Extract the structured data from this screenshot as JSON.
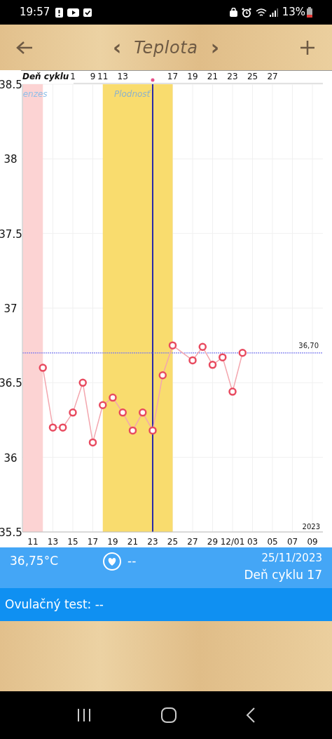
{
  "status_bar": {
    "time": "19:57",
    "battery": "13%"
  },
  "header": {
    "title": "Teplota",
    "prev": "‹",
    "next": "›"
  },
  "chart": {
    "chart_data": {
      "type": "line",
      "categories": [
        null,
        "11",
        null,
        "13",
        null,
        "15",
        null,
        "17",
        null,
        "19",
        null,
        "21",
        null,
        "23",
        null,
        "25",
        null,
        "27",
        null,
        "29",
        null,
        "12/01",
        null,
        "03",
        null,
        "05",
        null,
        "07",
        null,
        "09"
      ],
      "series": [
        {
          "color": "#e84a5f",
          "marker": "o",
          "values": [
            null,
            null,
            36.6,
            36.2,
            36.2,
            36.3,
            36.5,
            36.1,
            36.35,
            36.4,
            36.3,
            36.18,
            36.3,
            36.18,
            36.55,
            36.75,
            null,
            36.65,
            36.74,
            36.62,
            36.67,
            36.44,
            36.7,
            null,
            null,
            null,
            null,
            null,
            null,
            null
          ]
        }
      ],
      "ylim": [
        35.5,
        38.5
      ],
      "grid": true,
      "ref_lines": [
        {
          "axis": "y",
          "value": 36.7,
          "label": "36,70",
          "color": "#7b7bf0"
        }
      ],
      "yticks": [
        38.5,
        38,
        37.5,
        37,
        36.5,
        36,
        35.5
      ]
    },
    "top_axis_title": "Deň cyklu",
    "days": [
      {
        "kind": "menstruation"
      },
      {
        "kind": "menstruation"
      },
      {
        "kind": "normal"
      },
      {
        "kind": "normal"
      },
      {
        "kind": "normal"
      },
      {
        "kind": "normal",
        "cycle_day": "1"
      },
      {
        "kind": "normal"
      },
      {
        "kind": "normal",
        "cycle_day": "9"
      },
      {
        "kind": "fertile",
        "cycle_day": "11"
      },
      {
        "kind": "fertile"
      },
      {
        "kind": "fertile",
        "cycle_day": "13"
      },
      {
        "kind": "fertile"
      },
      {
        "kind": "fertile"
      },
      {
        "kind": "fertile",
        "ovulation": true
      },
      {
        "kind": "fertile"
      },
      {
        "kind": "normal",
        "cycle_day": "17"
      },
      {
        "kind": "normal"
      },
      {
        "kind": "normal",
        "cycle_day": "19"
      },
      {
        "kind": "normal"
      },
      {
        "kind": "normal",
        "cycle_day": "21"
      },
      {
        "kind": "normal"
      },
      {
        "kind": "normal",
        "cycle_day": "23"
      },
      {
        "kind": "normal"
      },
      {
        "kind": "normal",
        "cycle_day": "25"
      },
      {
        "kind": "normal"
      },
      {
        "kind": "normal",
        "cycle_day": "27"
      },
      {
        "kind": "normal"
      },
      {
        "kind": "normal"
      },
      {
        "kind": "normal"
      },
      {
        "kind": "normal"
      }
    ],
    "bands": [
      {
        "kind": "menstruation",
        "label": "enzes"
      },
      {
        "kind": "fertile",
        "label": "Plodnosť"
      }
    ],
    "year": "2023"
  },
  "info": {
    "temperature": "36,75°C",
    "intercourse": "--",
    "date": "25/11/2023",
    "cycle_day": "Deň cyklu 17"
  },
  "ovulation": {
    "text": "Ovulačný test: --"
  }
}
